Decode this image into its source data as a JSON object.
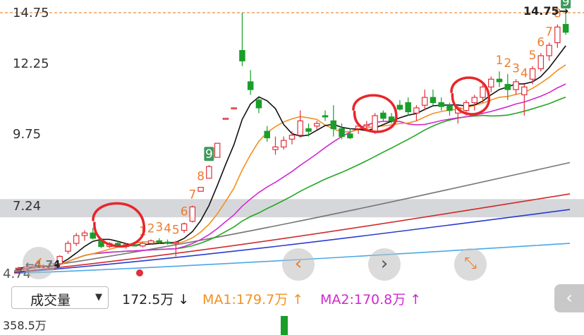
{
  "price_axis": {
    "labels": [
      "14.75",
      "12.25",
      "9.75",
      "7.24",
      "4.74"
    ]
  },
  "last_price_label": "14.75→",
  "low_label": "←4.74",
  "volume_panel": {
    "selector_label": "成交量",
    "selector_arrow": "▼",
    "current": "172.5万 ↓",
    "ma1": "MA1:179.7万 ↑",
    "ma2": "MA2:170.8万 ↑",
    "max_label": "358.5万"
  },
  "nav": {
    "prev_icon": "‹",
    "next_icon": "›",
    "expand_icon": "⤡",
    "collapse_icon": "‹"
  },
  "colors": {
    "up": "#e0303a",
    "down": "#1a9e2a",
    "ma5": "#111111",
    "ma10": "#f29120",
    "ma20": "#d02ad0",
    "ma30": "#22a622",
    "ma60": "#777777",
    "ma120": "#d02a2a",
    "ma250": "#2a3ad0",
    "ma500": "#4aa8e8",
    "td_counter": "#ee7d2c",
    "annotation": "#e8262a"
  },
  "chart_data": {
    "type": "candlestick",
    "ylim": [
      4.74,
      14.75
    ],
    "y_ticks": [
      14.75,
      12.25,
      9.75,
      7.24,
      4.74
    ],
    "reference_line": 14.75,
    "candles": [
      {
        "o": 4.9,
        "h": 5.0,
        "l": 4.74,
        "c": 4.95
      },
      {
        "o": 4.95,
        "h": 5.05,
        "l": 4.88,
        "c": 5.0
      },
      {
        "o": 5.0,
        "h": 5.1,
        "l": 4.92,
        "c": 5.02
      },
      {
        "o": 5.02,
        "h": 5.1,
        "l": 4.95,
        "c": 5.05
      },
      {
        "o": 5.05,
        "h": 5.2,
        "l": 4.98,
        "c": 5.12
      },
      {
        "o": 5.12,
        "h": 5.45,
        "l": 5.05,
        "c": 5.4
      },
      {
        "o": 5.6,
        "h": 6.0,
        "l": 5.5,
        "c": 5.9
      },
      {
        "o": 5.9,
        "h": 6.3,
        "l": 5.8,
        "c": 6.2
      },
      {
        "o": 6.2,
        "h": 6.4,
        "l": 6.0,
        "c": 6.3
      },
      {
        "o": 6.3,
        "h": 6.5,
        "l": 6.05,
        "c": 6.1
      },
      {
        "o": 6.0,
        "h": 6.05,
        "l": 5.72,
        "c": 5.78
      },
      {
        "o": 5.78,
        "h": 5.95,
        "l": 5.72,
        "c": 5.9
      },
      {
        "o": 5.9,
        "h": 6.0,
        "l": 5.75,
        "c": 5.82
      },
      {
        "o": 5.78,
        "h": 5.9,
        "l": 5.7,
        "c": 5.85
      },
      {
        "o": 5.85,
        "h": 5.95,
        "l": 5.78,
        "c": 5.8
      },
      {
        "o": 5.8,
        "h": 5.95,
        "l": 5.75,
        "c": 5.9
      },
      {
        "o": 5.9,
        "h": 6.05,
        "l": 5.85,
        "c": 6.0
      },
      {
        "o": 6.0,
        "h": 6.1,
        "l": 5.88,
        "c": 5.95
      },
      {
        "o": 5.95,
        "h": 6.05,
        "l": 5.85,
        "c": 5.92
      },
      {
        "o": 5.92,
        "h": 6.0,
        "l": 5.4,
        "c": 5.95
      },
      {
        "o": 6.4,
        "h": 6.7,
        "l": 6.3,
        "c": 6.65
      },
      {
        "o": 6.75,
        "h": 7.35,
        "l": 6.7,
        "c": 7.3
      },
      {
        "o": 7.9,
        "h": 8.05,
        "l": 7.9,
        "c": 8.05
      },
      {
        "o": 8.4,
        "h": 8.9,
        "l": 8.4,
        "c": 8.85
      },
      {
        "o": 9.2,
        "h": 9.75,
        "l": 9.2,
        "c": 9.74
      },
      {
        "o": 10.7,
        "h": 10.72,
        "l": 10.68,
        "c": 10.7
      },
      {
        "o": 11.1,
        "h": 11.12,
        "l": 11.08,
        "c": 11.1
      },
      {
        "o": 13.3,
        "h": 14.75,
        "l": 12.7,
        "c": 12.9
      },
      {
        "o": 12.1,
        "h": 12.55,
        "l": 11.6,
        "c": 11.8
      },
      {
        "o": 11.4,
        "h": 11.5,
        "l": 10.9,
        "c": 11.1
      },
      {
        "o": 10.2,
        "h": 10.4,
        "l": 9.8,
        "c": 9.95
      },
      {
        "o": 9.5,
        "h": 10.0,
        "l": 9.3,
        "c": 9.6
      },
      {
        "o": 9.6,
        "h": 10.0,
        "l": 9.5,
        "c": 9.85
      },
      {
        "o": 9.9,
        "h": 10.2,
        "l": 9.7,
        "c": 10.05
      },
      {
        "o": 10.05,
        "h": 11.0,
        "l": 9.95,
        "c": 10.6
      },
      {
        "o": 10.3,
        "h": 10.5,
        "l": 10.0,
        "c": 10.2
      },
      {
        "o": 10.4,
        "h": 10.6,
        "l": 10.25,
        "c": 10.5
      },
      {
        "o": 10.8,
        "h": 11.0,
        "l": 10.6,
        "c": 10.75
      },
      {
        "o": 10.6,
        "h": 11.2,
        "l": 10.0,
        "c": 10.3
      },
      {
        "o": 10.3,
        "h": 10.5,
        "l": 9.9,
        "c": 10.0
      },
      {
        "o": 10.1,
        "h": 10.3,
        "l": 9.9,
        "c": 9.95
      },
      {
        "o": 10.3,
        "h": 10.5,
        "l": 10.1,
        "c": 10.4
      },
      {
        "o": 10.4,
        "h": 10.6,
        "l": 10.2,
        "c": 10.45
      },
      {
        "o": 10.2,
        "h": 10.9,
        "l": 10.1,
        "c": 10.8
      },
      {
        "o": 10.9,
        "h": 11.0,
        "l": 10.6,
        "c": 10.7
      },
      {
        "o": 10.75,
        "h": 10.9,
        "l": 10.5,
        "c": 10.6
      },
      {
        "o": 11.2,
        "h": 11.4,
        "l": 11.0,
        "c": 11.05
      },
      {
        "o": 11.3,
        "h": 11.5,
        "l": 10.8,
        "c": 10.95
      },
      {
        "o": 10.9,
        "h": 11.2,
        "l": 10.6,
        "c": 11.1
      },
      {
        "o": 11.2,
        "h": 11.8,
        "l": 11.0,
        "c": 11.5
      },
      {
        "o": 11.5,
        "h": 11.8,
        "l": 11.2,
        "c": 11.3
      },
      {
        "o": 11.3,
        "h": 11.5,
        "l": 11.0,
        "c": 11.15
      },
      {
        "o": 11.2,
        "h": 11.3,
        "l": 10.8,
        "c": 11.0
      },
      {
        "o": 10.9,
        "h": 11.2,
        "l": 10.5,
        "c": 11.1
      },
      {
        "o": 11.0,
        "h": 11.4,
        "l": 10.8,
        "c": 11.3
      },
      {
        "o": 11.3,
        "h": 11.6,
        "l": 11.0,
        "c": 11.5
      },
      {
        "o": 11.5,
        "h": 12.0,
        "l": 11.3,
        "c": 11.9
      },
      {
        "o": 11.9,
        "h": 12.3,
        "l": 11.7,
        "c": 12.2
      },
      {
        "o": 12.2,
        "h": 12.5,
        "l": 11.9,
        "c": 12.1
      },
      {
        "o": 12.0,
        "h": 12.4,
        "l": 11.4,
        "c": 11.8
      },
      {
        "o": 11.8,
        "h": 12.2,
        "l": 11.6,
        "c": 12.1
      },
      {
        "o": 11.6,
        "h": 12.0,
        "l": 10.8,
        "c": 11.9
      },
      {
        "o": 12.2,
        "h": 12.7,
        "l": 12.0,
        "c": 12.6
      },
      {
        "o": 12.6,
        "h": 13.2,
        "l": 12.5,
        "c": 13.1
      },
      {
        "o": 13.1,
        "h": 13.6,
        "l": 12.9,
        "c": 13.5
      },
      {
        "o": 13.6,
        "h": 14.3,
        "l": 13.4,
        "c": 14.2
      },
      {
        "o": 14.3,
        "h": 14.75,
        "l": 13.9,
        "c": 14.0
      }
    ],
    "td_counters": [
      {
        "text": "1",
        "index": 15
      },
      {
        "text": "2",
        "index": 16
      },
      {
        "text": "3",
        "index": 17
      },
      {
        "text": "4",
        "index": 18
      },
      {
        "text": "5",
        "index": 19
      },
      {
        "text": "6",
        "index": 20
      },
      {
        "text": "7",
        "index": 21
      },
      {
        "text": "8",
        "index": 22
      },
      {
        "text": "9",
        "index": 23
      },
      {
        "text": "1",
        "index": 58
      },
      {
        "text": "2",
        "index": 59
      },
      {
        "text": "3",
        "index": 60
      },
      {
        "text": "4",
        "index": 61
      },
      {
        "text": "5",
        "index": 62
      },
      {
        "text": "6",
        "index": 63
      },
      {
        "text": "7",
        "index": 64
      },
      {
        "text": "8",
        "index": 65
      },
      {
        "text": "9",
        "index": 66
      }
    ]
  }
}
